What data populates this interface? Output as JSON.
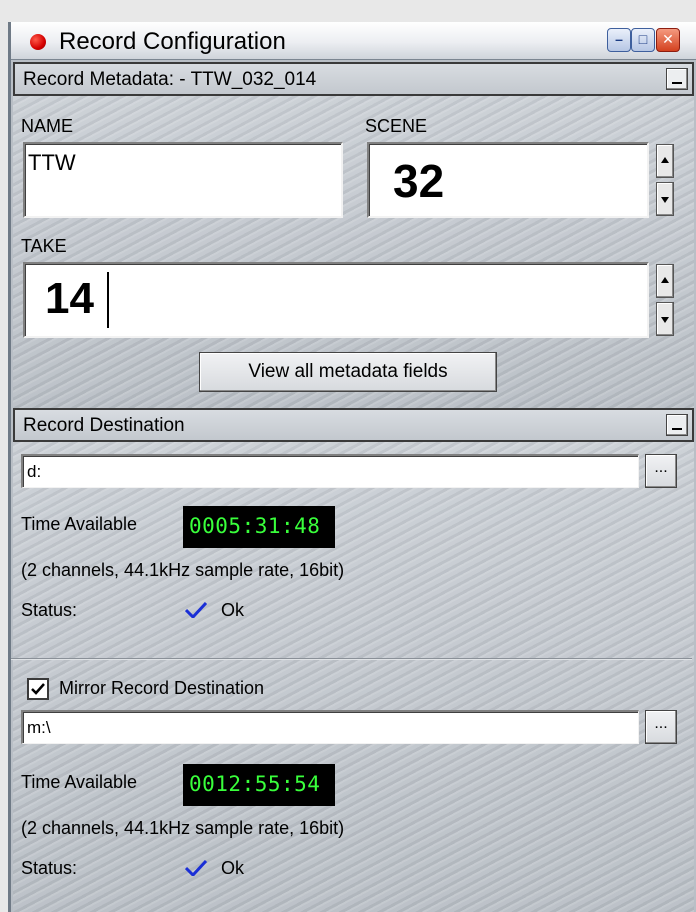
{
  "window": {
    "title": "Record Configuration",
    "minimize": "–",
    "maximize": "□",
    "close": "✕"
  },
  "metadata": {
    "header": "Record Metadata:  - TTW_032_014",
    "name_label": "NAME",
    "name_value": "TTW",
    "scene_label": "SCENE",
    "scene_value": "32",
    "take_label": "TAKE",
    "take_value": "14",
    "view_all_button": "View all metadata fields"
  },
  "destination": {
    "header": "Record Destination",
    "path": "d:",
    "browse_label": "...",
    "time_label": "Time Available",
    "time_value": "0005:31:48",
    "format_info": "(2 channels, 44.1kHz sample rate, 16bit)",
    "status_label": "Status:",
    "status_value": "Ok"
  },
  "mirror": {
    "checkbox_label": "Mirror Record Destination",
    "checked": true,
    "path": "m:\\",
    "browse_label": "...",
    "time_label": "Time Available",
    "time_value": "0012:55:54",
    "format_info": "(2 channels, 44.1kHz sample rate, 16bit)",
    "status_label": "Status:",
    "status_value": "Ok"
  },
  "colors": {
    "record_dot": "#d40000",
    "lcd_text": "#39ff3b",
    "check_blue": "#1a2fd6"
  }
}
